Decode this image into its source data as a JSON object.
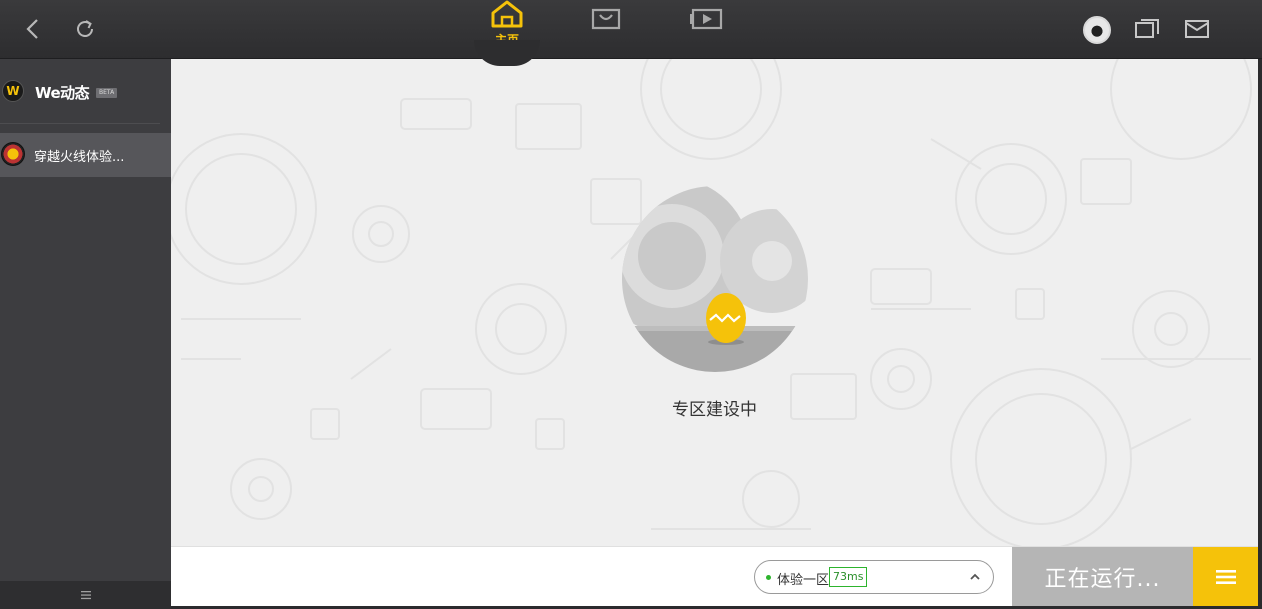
{
  "topbar": {
    "back_icon": "back-arrow-icon",
    "refresh_icon": "refresh-icon",
    "nav": {
      "home_label": "主页",
      "home_icon": "home-icon",
      "shop_icon": "shopping-bag-icon",
      "video_icon": "video-icon"
    },
    "right_icons": [
      "avatar",
      "chat-windows-icon",
      "mail-icon"
    ],
    "accent_color": "#f5c20a"
  },
  "sidebar": {
    "we_title": "We动态",
    "we_badge": "BETA",
    "game_item": "穿越火线体验...",
    "bottom_icon": "menu-lines-icon"
  },
  "main": {
    "status_text": "专区建设中",
    "illustration": "gear-and-egg-illustration"
  },
  "bottombar": {
    "server_name": "体验一区",
    "ping": "73ms",
    "server_status_color": "#2db42d",
    "running_label": "正在运行...",
    "menu_icon": "hamburger-icon"
  }
}
